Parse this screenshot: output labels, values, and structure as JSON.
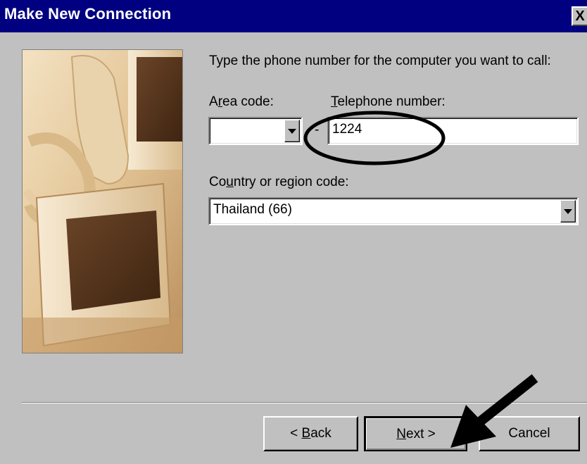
{
  "window": {
    "title": "Make New Connection",
    "close_label": "X",
    "titlebar_color": "#000080",
    "face_color": "#c0c0c0"
  },
  "illustration": {
    "description_icon": "telephone-and-monitors-image"
  },
  "instruction": "Type the phone number for the computer you want to call:",
  "area_code": {
    "label_pre": "A",
    "label_mnemonic": "r",
    "label_post": "ea code:",
    "value": ""
  },
  "telephone": {
    "label_mnemonic": "T",
    "label_post": "elephone number:",
    "separator": "-",
    "value": "1224"
  },
  "country": {
    "label_pre": "Co",
    "label_mnemonic": "u",
    "label_post": "ntry or region code:",
    "selected": "Thailand (66)"
  },
  "buttons": {
    "back_pre": "< ",
    "back_mnemonic": "B",
    "back_post": "ack",
    "next_mnemonic": "N",
    "next_post": "ext >",
    "cancel": "Cancel"
  },
  "annotations": {
    "circle_icon": "highlight-ellipse",
    "arrow_icon": "pointer-arrow",
    "color": "#000000"
  }
}
